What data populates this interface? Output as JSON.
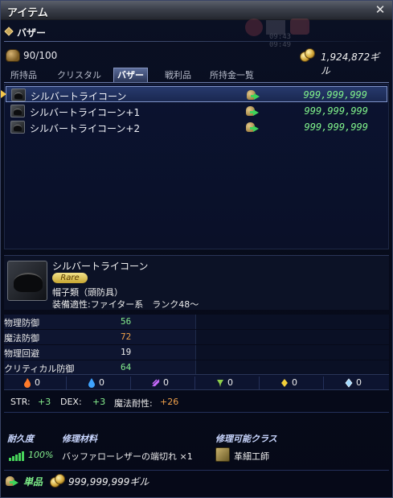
{
  "window": {
    "title": "アイテム",
    "close_icon": "close-icon"
  },
  "section": {
    "label": "バザー"
  },
  "background_timer": "09:43 09:49",
  "inventory": {
    "count_text": "90/100",
    "gil_text": "1,924,872ギル"
  },
  "tabs": [
    {
      "label": "所持品",
      "active": false
    },
    {
      "label": "クリスタル",
      "active": false
    },
    {
      "label": "バザー",
      "active": true
    },
    {
      "label": "戦利品",
      "active": false
    },
    {
      "label": "所持金一覧",
      "active": false
    }
  ],
  "items": [
    {
      "name": "シルバートライコーン",
      "price": "999,999,999",
      "selected": true
    },
    {
      "name": "シルバートライコーン+1",
      "price": "999,999,999",
      "selected": false
    },
    {
      "name": "シルバートライコーン+2",
      "price": "999,999,999",
      "selected": false
    }
  ],
  "detail": {
    "name": "シルバートライコーン",
    "rarity": "Rare",
    "category": "帽子類（頭防具）",
    "equip": "装備適性:ファイター系　ランク48～"
  },
  "stats": [
    {
      "label": "物理防御",
      "value": "56",
      "color": "#86f08e"
    },
    {
      "label": "魔法防御",
      "value": "72",
      "color": "#f0a14a"
    },
    {
      "label": "物理回避",
      "value": "19",
      "color": "#ececec"
    },
    {
      "label": "クリティカル防御",
      "value": "64",
      "color": "#86f08e"
    }
  ],
  "resists": [
    {
      "icon": "fire-icon",
      "value": "0"
    },
    {
      "icon": "water-icon",
      "value": "0"
    },
    {
      "icon": "wind-icon",
      "value": "0"
    },
    {
      "icon": "earth-icon",
      "value": "0"
    },
    {
      "icon": "light-icon",
      "value": "0"
    },
    {
      "icon": "dark-icon",
      "value": "0"
    }
  ],
  "attributes": {
    "str_label": "STR:",
    "str_value": "+3",
    "dex_label": "DEX:",
    "dex_value": "+3",
    "mres_label": "魔法耐性:",
    "mres_value": "+26"
  },
  "repair": {
    "durability_header": "耐久度",
    "material_header": "修理材料",
    "class_header": "修理可能クラス",
    "durability_value": "100%",
    "material_value": "バッファローレザーの端切れ ×1",
    "class_value": "革細工師"
  },
  "footer": {
    "unit_label": "単品",
    "price": "999,999,999ギル"
  }
}
